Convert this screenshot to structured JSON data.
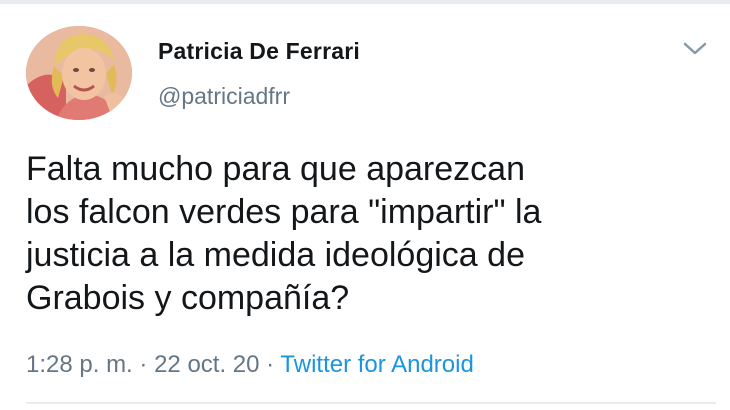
{
  "tweet": {
    "author": {
      "name": "Patricia De Ferrari",
      "handle": "@patriciadfrr",
      "avatar_icon": "profile-photo"
    },
    "caret_icon": "chevron-down-icon",
    "text": "Falta mucho para que aparezcan\nlos falcon verdes para \"impartir\" la\njusticia a la medida ideológica de\nGrabois y compañía?",
    "time": "1:28 p. m.",
    "date": "22 oct. 20",
    "separator": "·",
    "source": "Twitter for Android",
    "colors": {
      "text": "#14171a",
      "secondary": "#657786",
      "link": "#1b95e0"
    }
  }
}
